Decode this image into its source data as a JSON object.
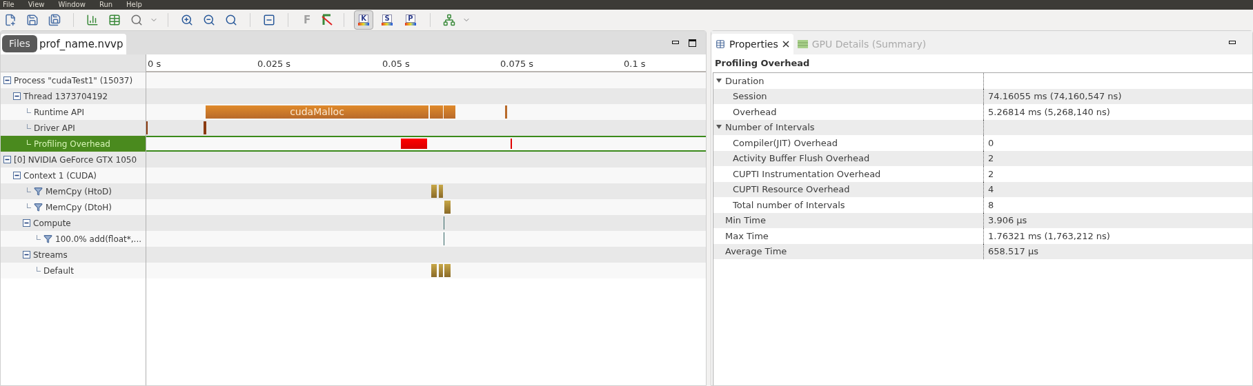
{
  "menu": [
    "File",
    "View",
    "Window",
    "Run",
    "Help"
  ],
  "toolbar": {
    "filter_button": {
      "label": "F",
      "disabled": true
    },
    "view_buttons": [
      {
        "label": "K",
        "selected": true
      },
      {
        "label": "S",
        "selected": false
      },
      {
        "label": "P",
        "selected": false
      }
    ]
  },
  "editor": {
    "tab": {
      "label": "prof_name.nvvp",
      "selected": true
    },
    "tooltip": "Files",
    "ticks": [
      "0 s",
      "0.025 s",
      "0.05 s",
      "0.075 s",
      "0.1 s"
    ],
    "tree": [
      {
        "label": "Process \"cudaTest1\" (15037)",
        "kind": "node",
        "expanded": true,
        "filter": false,
        "selected": false,
        "children": [
          {
            "label": "Thread 1373704192",
            "kind": "node",
            "expanded": true,
            "filter": false,
            "selected": false,
            "children": [
              {
                "label": "Runtime API",
                "kind": "leaf",
                "filter": false,
                "selected": false,
                "bar_label": "cudaMalloc"
              },
              {
                "label": "Driver API",
                "kind": "leaf",
                "filter": false,
                "selected": false
              },
              {
                "label": "Profiling Overhead",
                "kind": "leaf",
                "filter": false,
                "selected": true
              }
            ]
          }
        ]
      },
      {
        "label": "[0] NVIDIA GeForce GTX 1050",
        "kind": "node",
        "expanded": true,
        "filter": false,
        "selected": false,
        "children": [
          {
            "label": "Context 1 (CUDA)",
            "kind": "node",
            "expanded": true,
            "filter": false,
            "selected": false,
            "children": [
              {
                "label": "MemCpy (HtoD)",
                "kind": "leaf",
                "filter": true,
                "selected": false
              },
              {
                "label": "MemCpy (DtoH)",
                "kind": "leaf",
                "filter": true,
                "selected": false
              },
              {
                "label": "Compute",
                "kind": "node",
                "expanded": true,
                "filter": false,
                "selected": false,
                "children": [
                  {
                    "label": "100.0% add(float*,...",
                    "kind": "leaf",
                    "filter": true,
                    "selected": false
                  }
                ]
              },
              {
                "label": "Streams",
                "kind": "node",
                "expanded": true,
                "filter": false,
                "selected": false,
                "children": [
                  {
                    "label": "Default",
                    "kind": "leaf",
                    "filter": false,
                    "selected": false
                  }
                ]
              }
            ]
          }
        ]
      }
    ]
  },
  "properties": {
    "tabs": [
      {
        "label": "Properties",
        "selected": true
      },
      {
        "label": "GPU Details (Summary)",
        "selected": false
      }
    ],
    "title": "Profiling Overhead",
    "rows": [
      {
        "kind": "group",
        "label": "Duration",
        "expanded": true
      },
      {
        "kind": "item",
        "label": "Session",
        "value": "74.16055 ms (74,160,547 ns)"
      },
      {
        "kind": "item",
        "label": "Overhead",
        "value": "5.26814 ms (5,268,140 ns)"
      },
      {
        "kind": "group",
        "label": "Number of Intervals",
        "expanded": true
      },
      {
        "kind": "item",
        "label": "Compiler(JIT) Overhead",
        "value": "0"
      },
      {
        "kind": "item",
        "label": "Activity Buffer Flush Overhead",
        "value": "2"
      },
      {
        "kind": "item",
        "label": "CUPTI Instrumentation Overhead",
        "value": "2"
      },
      {
        "kind": "item",
        "label": "CUPTI Resource Overhead",
        "value": "4"
      },
      {
        "kind": "item",
        "label": "Total number of Intervals",
        "value": "8"
      },
      {
        "kind": "top",
        "label": "Min Time",
        "value": "3.906 µs"
      },
      {
        "kind": "top",
        "label": "Max Time",
        "value": "1.76321 ms (1,763,212 ns)"
      },
      {
        "kind": "top",
        "label": "Average Time",
        "value": "658.517 µs"
      }
    ]
  }
}
